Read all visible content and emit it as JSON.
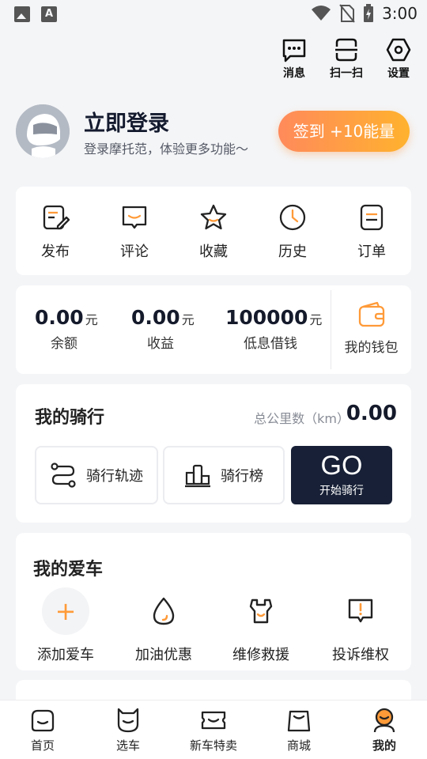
{
  "status_bar": {
    "time": "3:00",
    "left_icons": [
      "image-icon",
      "font-a-icon"
    ],
    "right_icons": [
      "wifi-icon",
      "no-sim-icon",
      "battery-charging-icon"
    ],
    "font_icon_letter": "A"
  },
  "top_actions": [
    {
      "label": "消息",
      "icon": "message-icon"
    },
    {
      "label": "扫一扫",
      "icon": "scan-icon"
    },
    {
      "label": "设置",
      "icon": "settings-icon"
    }
  ],
  "profile": {
    "title": "立即登录",
    "subtitle": "登录摩托范，体验更多功能～",
    "checkin_label": "签到 +10能量"
  },
  "quick_actions": [
    {
      "label": "发布",
      "icon": "edit-icon"
    },
    {
      "label": "评论",
      "icon": "comment-icon"
    },
    {
      "label": "收藏",
      "icon": "star-icon"
    },
    {
      "label": "历史",
      "icon": "clock-icon"
    },
    {
      "label": "订单",
      "icon": "order-icon"
    }
  ],
  "finance": {
    "balance": {
      "value": "0.00",
      "unit": "元",
      "label": "余额"
    },
    "earnings": {
      "value": "0.00",
      "unit": "元",
      "label": "收益"
    },
    "loan": {
      "value": "100000",
      "unit": "元",
      "label": "低息借钱"
    },
    "wallet_label": "我的钱包"
  },
  "riding": {
    "title": "我的骑行",
    "km_label": "总公里数（km）",
    "km_value": "0.00",
    "track_label": "骑行轨迹",
    "rank_label": "骑行榜",
    "go_label": "GO",
    "go_sub": "开始骑行"
  },
  "my_car": {
    "title": "我的爱车",
    "plus_symbol": "+",
    "items": [
      {
        "label": "添加爱车",
        "icon": "plus-icon"
      },
      {
        "label": "加油优惠",
        "icon": "fuel-drop-icon"
      },
      {
        "label": "维修救援",
        "icon": "wrench-icon"
      },
      {
        "label": "投诉维权",
        "icon": "complaint-icon"
      }
    ]
  },
  "tabs": [
    {
      "label": "首页",
      "icon": "home-icon"
    },
    {
      "label": "选车",
      "icon": "car-select-icon"
    },
    {
      "label": "新车特卖",
      "icon": "ticket-icon"
    },
    {
      "label": "商城",
      "icon": "shop-bag-icon"
    },
    {
      "label": "我的",
      "icon": "profile-icon",
      "active": true
    }
  ],
  "colors": {
    "accent_orange": "#ff9a38",
    "dark_navy": "#172036",
    "background": "#f4f5f7"
  }
}
